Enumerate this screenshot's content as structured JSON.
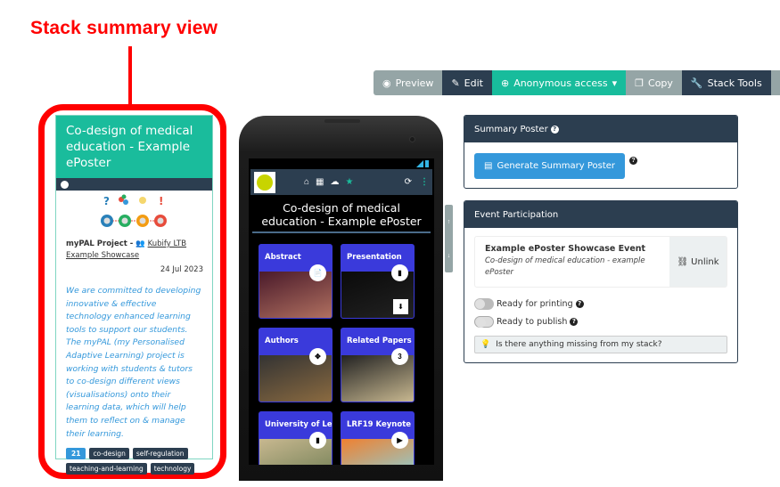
{
  "annotation": {
    "title": "Stack summary view"
  },
  "toolbar": {
    "preview": {
      "icon": "eye-icon",
      "label": "Preview"
    },
    "edit": {
      "icon": "edit-icon",
      "label": "Edit"
    },
    "anonymous": {
      "icon": "globe-icon",
      "label": "Anonymous access",
      "caret": "▾"
    },
    "copy": {
      "icon": "copy-icon",
      "label": "Copy"
    },
    "stack_tools": {
      "icon": "wrench-icon",
      "label": "Stack Tools"
    },
    "more": {
      "icon": "ellipsis-vertical-icon",
      "label": "⋮"
    }
  },
  "summary_card": {
    "title": "Co-design of medical education - Example ePoster",
    "project": "myPAL Project - ",
    "owner_link": "Kubify LTB Example Showcase",
    "date": "24 Jul 2023",
    "description": "We are committed to developing innovative & effective technology enhanced learning tools to support our students. The myPAL (my Personalised Adaptive Learning) project is working with students & tutors to co-design different views (visualisations) onto their learning data, which will help them to reflect on & manage their learning.",
    "count": "21",
    "tags": [
      "co-design",
      "self-regulation",
      "teaching-and-learning",
      "technology"
    ]
  },
  "phone": {
    "title": "Co-design of medical education - Example ePoster",
    "tiles": [
      {
        "label": "Abstract",
        "badge": "📄",
        "colors": [
          "#4a1a2a",
          "#b07060"
        ]
      },
      {
        "label": "Presentation",
        "badge": "▮",
        "corner": "⬇",
        "colors": [
          "#0a0a0a",
          "#222"
        ]
      },
      {
        "label": "Authors",
        "badge": "✥",
        "colors": [
          "#333",
          "#8a6a40"
        ]
      },
      {
        "label": "Related Papers",
        "badge": "3",
        "colors": [
          "#222",
          "#c8b890"
        ]
      },
      {
        "label": "University of Lee",
        "badge": "▮",
        "corner": "↗",
        "colors": [
          "#c8b890",
          "#6a7a50"
        ]
      },
      {
        "label": "LRF19 Keynote",
        "badge": "▶",
        "corner": "↗",
        "colors": [
          "#f08030",
          "#80d8e8"
        ]
      }
    ]
  },
  "summary_poster": {
    "heading": "Summary Poster",
    "button": "Generate Summary Poster"
  },
  "event_participation": {
    "heading": "Event Participation",
    "event_name": "Example ePoster Showcase Event",
    "event_sub": "Co-design of medical education - example ePoster",
    "unlink": "Unlink",
    "ready_printing": "Ready for printing",
    "ready_publish": "Ready to publish",
    "missing": "Is there anything missing from my stack?"
  }
}
